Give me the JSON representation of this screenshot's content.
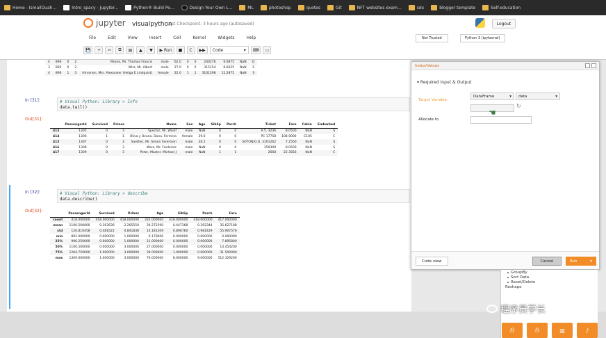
{
  "bookmarks": [
    {
      "label": "Home - IsmailOuah...",
      "icon": "folder-icon"
    },
    {
      "label": "Intro_spacy - Jupyter...",
      "icon": "page-icon"
    },
    {
      "label": "Python® Build Po...",
      "icon": "page-icon"
    },
    {
      "label": "Design Your Own L...",
      "icon": "dark-icon"
    },
    {
      "label": "ML",
      "icon": "folder-icon"
    },
    {
      "label": "photoshop",
      "icon": "folder-icon"
    },
    {
      "label": "quotes",
      "icon": "folder-icon"
    },
    {
      "label": "Git",
      "icon": "folder-icon"
    },
    {
      "label": "NFT websites exam...",
      "icon": "folder-icon"
    },
    {
      "label": "sdx",
      "icon": "folder-icon"
    },
    {
      "label": "blogger template",
      "icon": "folder-icon"
    },
    {
      "label": "Self-education",
      "icon": "folder-icon"
    }
  ],
  "header": {
    "logo": "jupyter",
    "notebook_name": "visualpython",
    "checkpoint": "Last Checkpoint: 3 hours ago (autosaved)",
    "logout": "Logout",
    "trusted": "Not Trusted",
    "kernel": "Python 3 (ipykernel)"
  },
  "menu": [
    "File",
    "Edit",
    "View",
    "Insert",
    "Cell",
    "Kernel",
    "Widgets",
    "Help"
  ],
  "toolbar": {
    "buttons": [
      "💾",
      "+",
      "✂",
      "⧉",
      "▤",
      "▲",
      "▼"
    ],
    "run": "▶ Run",
    "stop": "■",
    "restart": "C",
    "fast": "▶▶",
    "cell_type": "Code",
    "extra": [
      "⌨",
      "▭"
    ]
  },
  "top_table": {
    "rows": [
      [
        "4",
        "896",
        "0",
        "2",
        "Moses, Mr. Thomas Francis",
        "male",
        "62.0",
        "0",
        "0",
        "240276",
        "9.6875",
        "NaN",
        "Q"
      ],
      [
        "3",
        "895",
        "0",
        "2",
        "Wirz, Mr. Albert",
        "male",
        "27.0",
        "0",
        "0",
        "315154",
        "8.6625",
        "NaN",
        "S"
      ],
      [
        "4",
        "896",
        "1",
        "3",
        "Hirvonen, Mrs. Alexander (Helga E Lindqvist)",
        "female",
        "22.0",
        "1",
        "1",
        "3101298",
        "12.2875",
        "NaN",
        "S"
      ]
    ]
  },
  "cell31": {
    "prompt_in": "In [31]:",
    "comment": "# Visual Python: Library > Info",
    "code": "data.tail()",
    "prompt_out": "Out[31]:",
    "columns": [
      "",
      "PassengerId",
      "Survived",
      "Pclass",
      "Name",
      "Sex",
      "Age",
      "SibSp",
      "Parch",
      "Ticket",
      "Fare",
      "Cabin",
      "Embarked"
    ],
    "rows": [
      [
        "413",
        "1305",
        "0",
        "3",
        "Spector, Mr. Woolf",
        "male",
        "NaN",
        "0",
        "0",
        "A.5. 3236",
        "8.0500",
        "NaN",
        "S"
      ],
      [
        "414",
        "1306",
        "1",
        "1",
        "Oliva y Ocana, Dona. Fermina",
        "female",
        "39.0",
        "0",
        "0",
        "PC 17758",
        "108.9000",
        "C105",
        "C"
      ],
      [
        "415",
        "1307",
        "0",
        "3",
        "Saether, Mr. Simon Sivertsen",
        "male",
        "38.5",
        "0",
        "0",
        "SOTON/O.Q. 3101262",
        "7.2500",
        "NaN",
        "S"
      ],
      [
        "416",
        "1308",
        "0",
        "3",
        "Ware, Mr. Frederick",
        "male",
        "NaN",
        "0",
        "0",
        "359309",
        "8.0500",
        "NaN",
        "S"
      ],
      [
        "417",
        "1309",
        "0",
        "3",
        "Peter, Master. Michael J",
        "male",
        "NaN",
        "1",
        "1",
        "2668",
        "22.3583",
        "NaN",
        "C"
      ]
    ]
  },
  "cell32": {
    "prompt_in": "In [32]:",
    "comment": "# Visual Python: Library > describe",
    "code": "data.describe()",
    "prompt_out": "Out[32]:",
    "columns": [
      "",
      "PassengerId",
      "Survived",
      "Pclass",
      "Age",
      "SibSp",
      "Parch",
      "Fare"
    ],
    "rows": [
      [
        "count",
        "418.000000",
        "418.000000",
        "418.000000",
        "332.000000",
        "418.000000",
        "418.000000",
        "417.000000"
      ],
      [
        "mean",
        "1100.500000",
        "0.363636",
        "2.265550",
        "30.272590",
        "0.447368",
        "0.392344",
        "35.627188"
      ],
      [
        "std",
        "120.810458",
        "0.481622",
        "0.841838",
        "14.181209",
        "0.896760",
        "0.981429",
        "55.907576"
      ],
      [
        "min",
        "892.000000",
        "0.000000",
        "1.000000",
        "0.170000",
        "0.000000",
        "0.000000",
        "0.000000"
      ],
      [
        "25%",
        "996.250000",
        "0.000000",
        "1.000000",
        "21.000000",
        "0.000000",
        "0.000000",
        "7.895800"
      ],
      [
        "50%",
        "1100.500000",
        "0.000000",
        "3.000000",
        "27.000000",
        "0.000000",
        "0.000000",
        "14.454200"
      ],
      [
        "75%",
        "1204.750000",
        "1.000000",
        "3.000000",
        "39.000000",
        "1.000000",
        "0.000000",
        "31.500000"
      ],
      [
        "max",
        "1309.000000",
        "1.000000",
        "3.000000",
        "76.000000",
        "8.000000",
        "9.000000",
        "512.329200"
      ]
    ]
  },
  "dialog": {
    "title": "Index/Values",
    "section": "Required Input & Output",
    "target_label": "Target Variable",
    "target_type": "DataFrame",
    "target_value": "data",
    "allocate_label": "Allocate to",
    "code_view": "Code view",
    "cancel": "Cancel",
    "run": "Run"
  },
  "side_panel": [
    "GroupBy",
    "Sort Data",
    "Reset/Delete",
    "Reshape"
  ],
  "watermark": "程序员学长",
  "bottom_icons": [
    "⎙",
    "⎙",
    "▥",
    "♪"
  ]
}
